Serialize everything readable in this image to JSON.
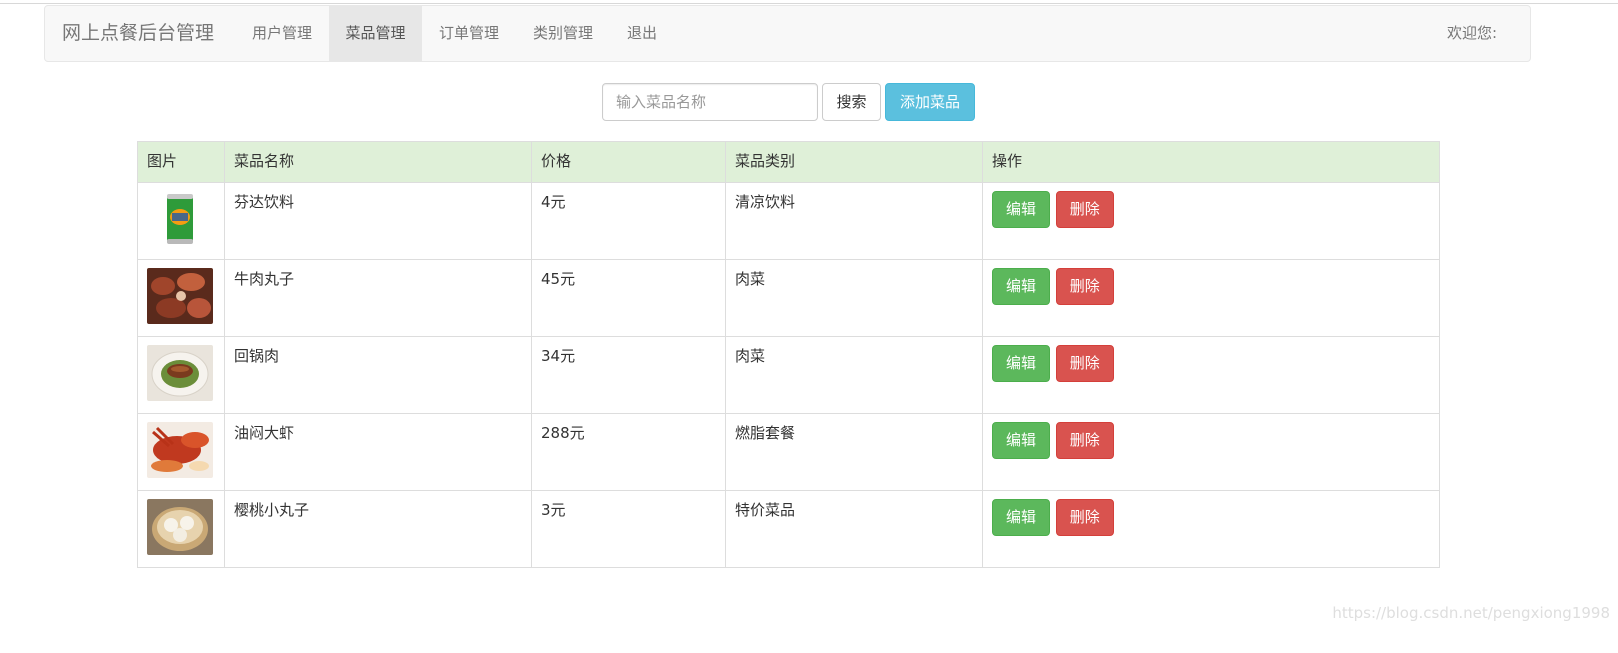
{
  "navbar": {
    "brand": "网上点餐后台管理",
    "items": [
      {
        "label": "用户管理",
        "active": false
      },
      {
        "label": "菜品管理",
        "active": true
      },
      {
        "label": "订单管理",
        "active": false
      },
      {
        "label": "类别管理",
        "active": false
      },
      {
        "label": "退出",
        "active": false
      }
    ],
    "welcome": "欢迎您:"
  },
  "search": {
    "placeholder": "输入菜品名称",
    "value": "",
    "search_label": "搜索",
    "add_label": "添加菜品"
  },
  "table": {
    "headers": [
      "图片",
      "菜品名称",
      "价格",
      "菜品类别",
      "操作"
    ],
    "edit_label": "编辑",
    "delete_label": "删除",
    "rows": [
      {
        "image": "fanta-can-image",
        "name": "芬达饮料",
        "price": "4元",
        "category": "清凉饮料"
      },
      {
        "image": "beef-dish-image",
        "name": "牛肉丸子",
        "price": "45元",
        "category": "肉菜"
      },
      {
        "image": "twice-cooked-pork-image",
        "name": "回锅肉",
        "price": "34元",
        "category": "肉菜"
      },
      {
        "image": "braised-lobster-image",
        "name": "油闷大虾",
        "price": "288元",
        "category": "燃脂套餐"
      },
      {
        "image": "dumpling-steamer-image",
        "name": "樱桃小丸子",
        "price": "3元",
        "category": "特价菜品"
      }
    ]
  },
  "watermark": "https://blog.csdn.net/pengxiong1998",
  "colors": {
    "header_bg": "#dff0d8",
    "success": "#5cb85c",
    "danger": "#d9534f",
    "info": "#5bc0de"
  }
}
